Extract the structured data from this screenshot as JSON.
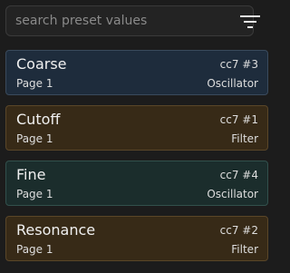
{
  "search": {
    "placeholder": "search preset values",
    "value": ""
  },
  "filter_button": {
    "icon": "filter-lines-icon"
  },
  "presets": [
    {
      "name": "Coarse",
      "cc": "cc7 #3",
      "page": "Page 1",
      "section": "Oscillator",
      "color": "#1e2c3c"
    },
    {
      "name": "Cutoff",
      "cc": "cc7 #1",
      "page": "Page 1",
      "section": "Filter",
      "color": "#372a17"
    },
    {
      "name": "Fine",
      "cc": "cc7 #4",
      "page": "Page 1",
      "section": "Oscillator",
      "color": "#1b2d2c"
    },
    {
      "name": "Resonance",
      "cc": "cc7 #2",
      "page": "Page 1",
      "section": "Filter",
      "color": "#372a17"
    }
  ]
}
